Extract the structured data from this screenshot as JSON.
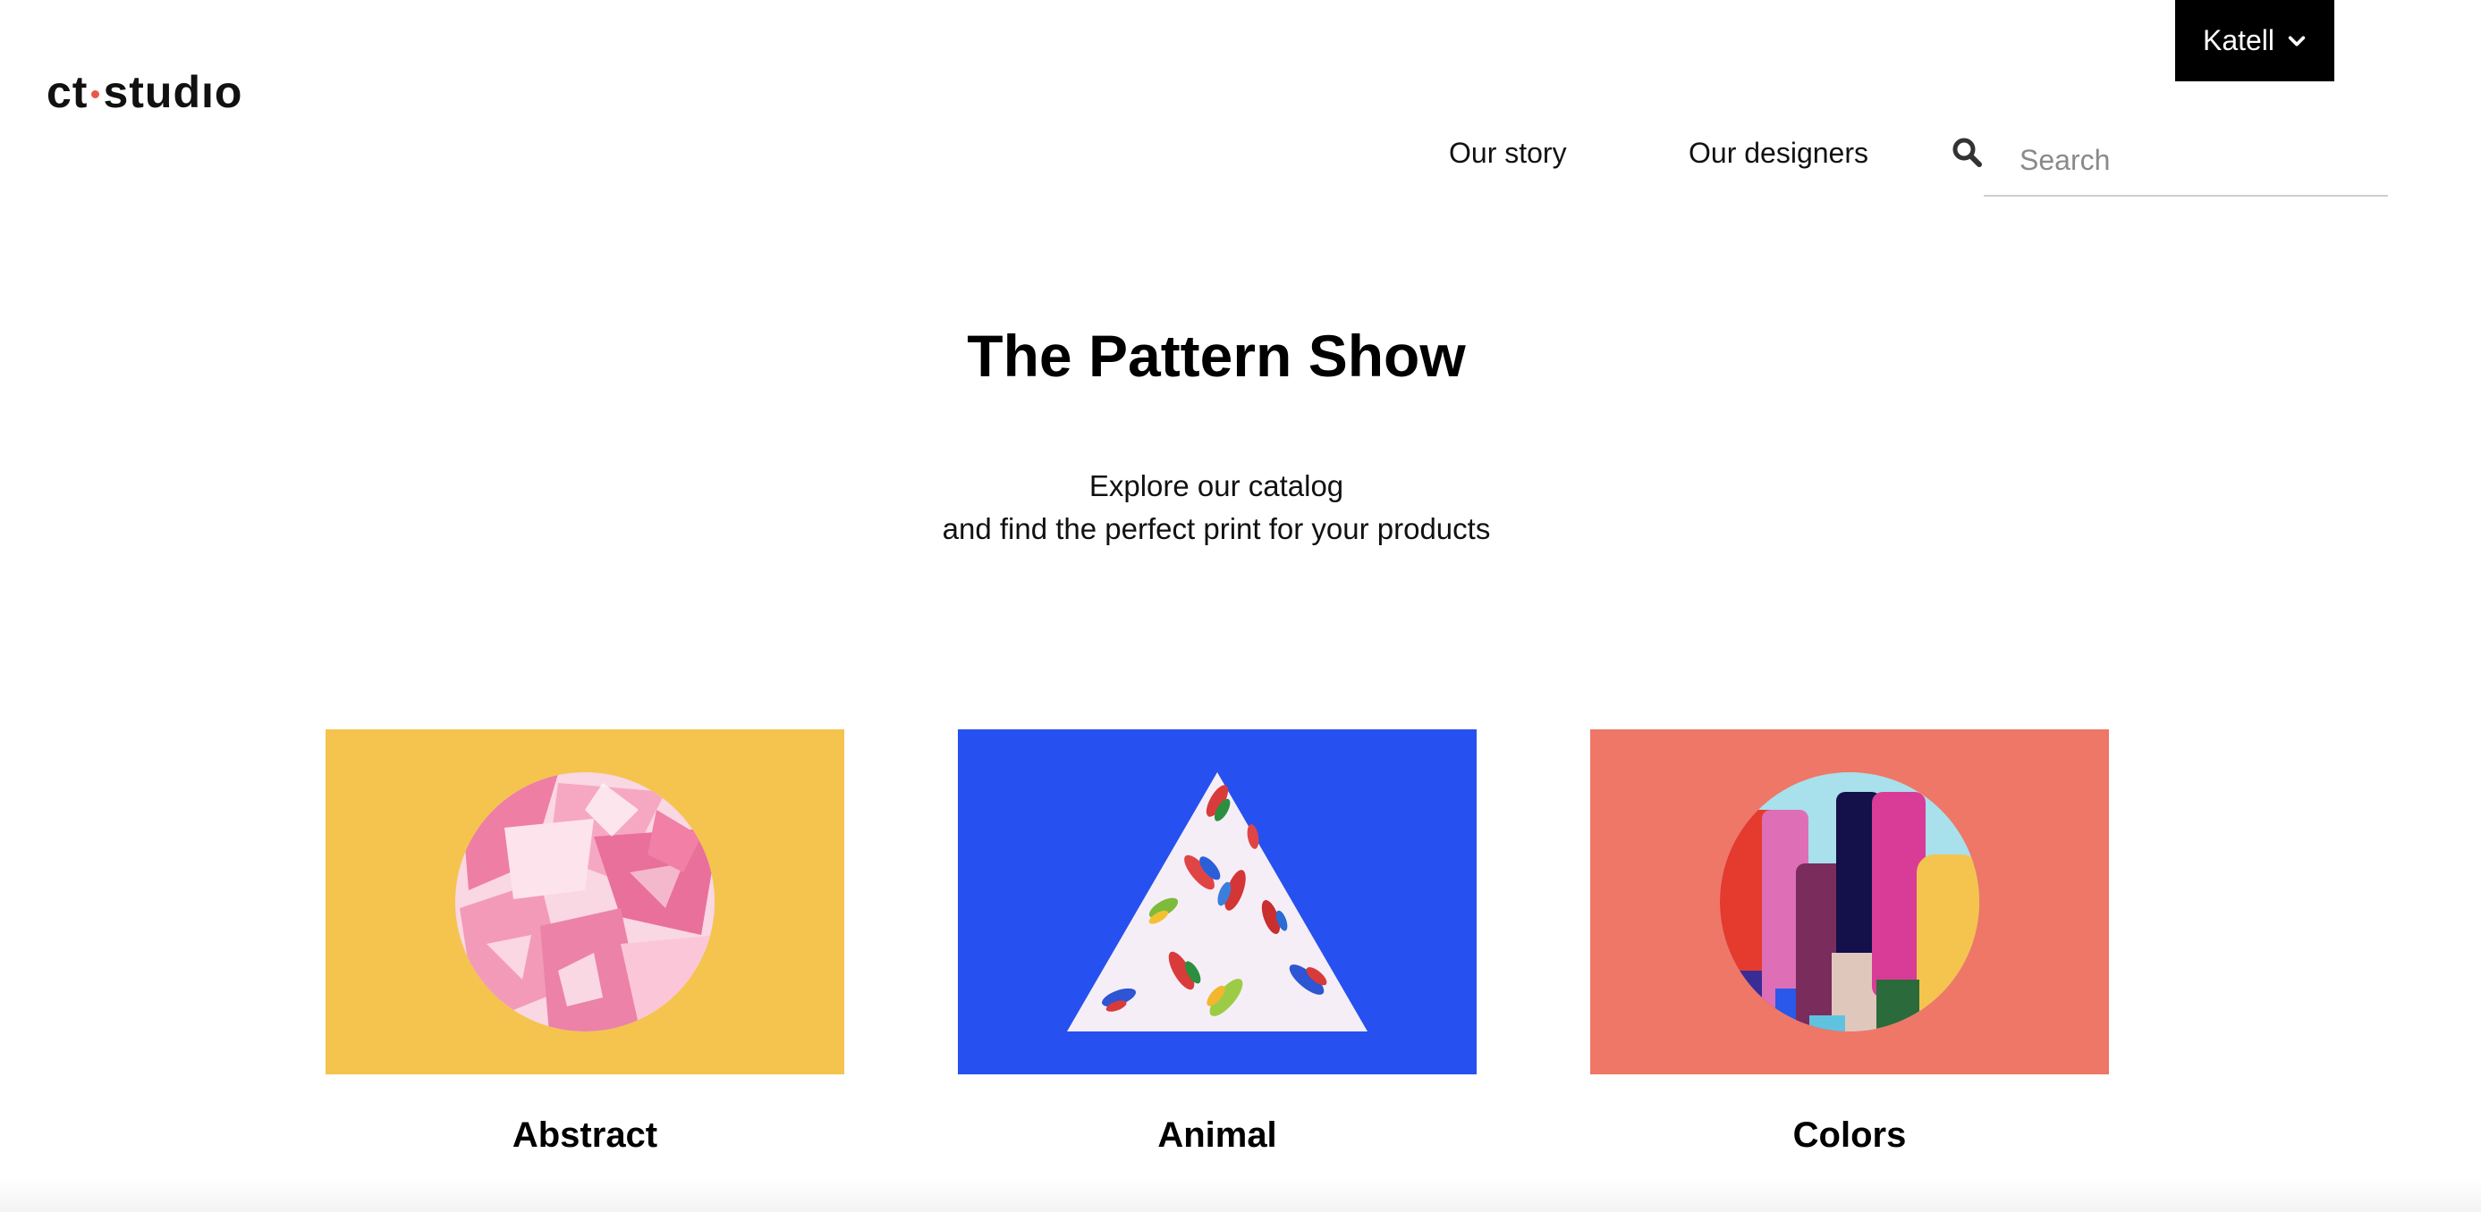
{
  "header": {
    "logo_left": "ct",
    "logo_right": "studıo",
    "user_menu_label": "Katell",
    "nav": {
      "story": "Our story",
      "designers": "Our designers"
    },
    "search_placeholder": "Search"
  },
  "hero": {
    "title": "The Pattern Show",
    "subtitle_line1": "Explore our catalog",
    "subtitle_line2": "and find the perfect print for your products"
  },
  "categories": [
    {
      "label": "Abstract",
      "bg": "#f4c44f"
    },
    {
      "label": "Animal",
      "bg": "#2651f0"
    },
    {
      "label": "Colors",
      "bg": "#ee7768"
    }
  ],
  "icons": {
    "user_menu": "chevron-down-icon",
    "search": "search-icon"
  },
  "colors": {
    "logo_dot": "#e8584a",
    "user_menu_bg": "#000000"
  }
}
